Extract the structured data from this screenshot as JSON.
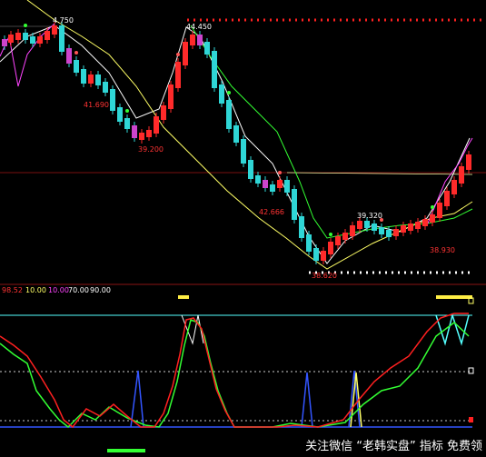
{
  "chart_data": [
    {
      "type": "candlestick",
      "title": "",
      "price_labels": [
        "4.750",
        "44.450",
        "41.690",
        "39.200",
        "42.666",
        "38.620",
        "39.320",
        "38.930"
      ],
      "range_label": "",
      "colors": {
        "up": "#ff2a2a",
        "down": "#2fd6d6",
        "ma_fast": "#ffffff",
        "ma_mid": "#ffff66",
        "ma_slow": "#33ff33",
        "ma_long": "#ff44ff",
        "resistance": "#ff2020",
        "support": "#ffffff"
      }
    },
    {
      "type": "line",
      "title": "",
      "header_values": [
        "98.52",
        "10.00",
        "10.00",
        "70.00",
        "90.00"
      ],
      "colors": {
        "main": "#ff2020",
        "secondary": "#33ff33",
        "signal_up": "#ffff44",
        "signal_down": "#3355ff",
        "band": "#55ffff"
      }
    }
  ],
  "watermark": "关注微信 “老韩实盘” 指标 免费领"
}
